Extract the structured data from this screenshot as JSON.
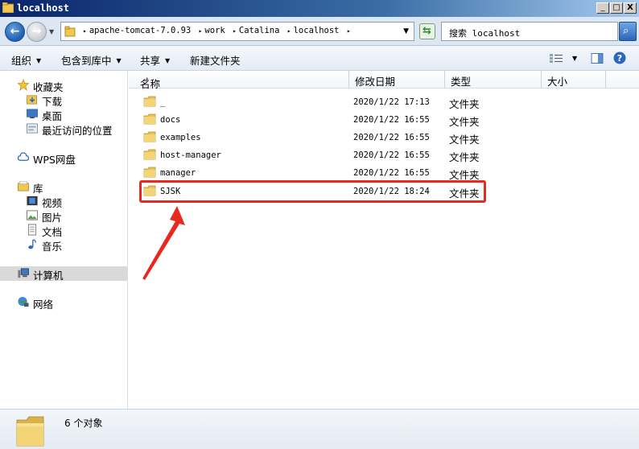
{
  "window": {
    "title": "localhost",
    "min_label": "_",
    "max_label": "□",
    "close_label": "X"
  },
  "address": {
    "crumbs": [
      "apache-tomcat-7.0.93",
      "work",
      "Catalina",
      "localhost"
    ],
    "search_placeholder": "搜索 localhost"
  },
  "toolbar": {
    "organize": "组织",
    "include_library": "包含到库中",
    "share": "共享",
    "new_folder": "新建文件夹"
  },
  "nav": {
    "favorites": "收藏夹",
    "downloads": "下载",
    "desktop": "桌面",
    "recent": "最近访问的位置",
    "wps": "WPS网盘",
    "libraries": "库",
    "videos": "视频",
    "pictures": "图片",
    "documents": "文档",
    "music": "音乐",
    "computer": "计算机",
    "network": "网络"
  },
  "columns": {
    "name": "名称",
    "modified": "修改日期",
    "type": "类型",
    "size": "大小"
  },
  "files": [
    {
      "name": "_",
      "date": "2020/1/22 17:13",
      "type": "文件夹"
    },
    {
      "name": "docs",
      "date": "2020/1/22 16:55",
      "type": "文件夹"
    },
    {
      "name": "examples",
      "date": "2020/1/22 16:55",
      "type": "文件夹"
    },
    {
      "name": "host-manager",
      "date": "2020/1/22 16:55",
      "type": "文件夹"
    },
    {
      "name": "manager",
      "date": "2020/1/22 16:55",
      "type": "文件夹"
    },
    {
      "name": "SJSK",
      "date": "2020/1/22 18:24",
      "type": "文件夹"
    }
  ],
  "status": {
    "count": "6 个对象"
  },
  "colors": {
    "annotation": "#e8291f",
    "folder": "#e8c45a"
  }
}
